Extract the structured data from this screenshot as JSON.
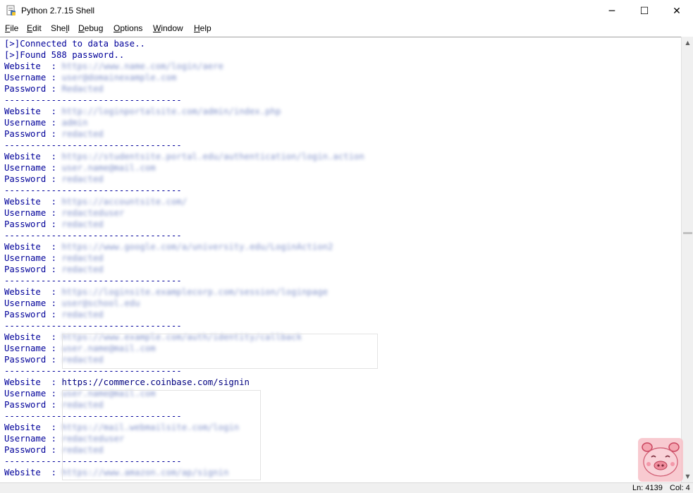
{
  "window": {
    "title": "Python 2.7.15 Shell",
    "minimize_glyph": "─",
    "maximize_glyph": "☐",
    "close_glyph": "✕"
  },
  "menu": [
    {
      "pre": "",
      "u": "F",
      "post": "ile"
    },
    {
      "pre": "",
      "u": "E",
      "post": "dit"
    },
    {
      "pre": "She",
      "u": "l",
      "post": "l"
    },
    {
      "pre": "",
      "u": "D",
      "post": "ebug"
    },
    {
      "pre": "",
      "u": "O",
      "post": "ptions"
    },
    {
      "pre": "",
      "u": "W",
      "post": "indow"
    },
    {
      "pre": "",
      "u": "H",
      "post": "elp"
    }
  ],
  "shell": {
    "status_lines": [
      "[>]Connected to data base..",
      "[>]Found 588 password.."
    ],
    "separator": "----------------------------------",
    "labels": {
      "website": "Website  : ",
      "username": "Username : ",
      "password": "Password : "
    },
    "entries": [
      {
        "website": "https://www.name.com/login/aere",
        "username": "user@domainexample.com",
        "password": "Redacted"
      },
      {
        "website": "http://loginportalsite.com/admin/index.php",
        "username": "admin",
        "password": "redacted"
      },
      {
        "website": "https://studentsite.portal.edu/authentication/login.action",
        "username": "user.name@mail.com",
        "password": "redacted"
      },
      {
        "website": "https://accountsite.com/",
        "username": "redacteduser",
        "password": "redacted"
      },
      {
        "website": "https://www.google.com/a/university.edu/LoginAction2",
        "username": "redacted",
        "password": "redacted"
      },
      {
        "website": "https://loginsite.examplecorp.com/session/loginpage",
        "username": "user@school.edu",
        "password": "redacted"
      },
      {
        "website": "https://www.example.com/auth/identity/callback",
        "username": "user.name@mail.com",
        "password": "redacted"
      },
      {
        "website": "https://commerce.coinbase.com/signin",
        "username": "user.name@mail.com",
        "password": "redacted"
      },
      {
        "website": "https://mail.webmailsite.com/login",
        "username": "redacteduser",
        "password": "redacted"
      },
      {
        "website": "https://www.amazon.com/ap/signin",
        "username": "",
        "password": ""
      }
    ]
  },
  "status_bar": {
    "ln": "Ln: 4139",
    "col": "Col: 4"
  },
  "colors": {
    "output_blue": "#00009a",
    "background": "#ffffff"
  }
}
